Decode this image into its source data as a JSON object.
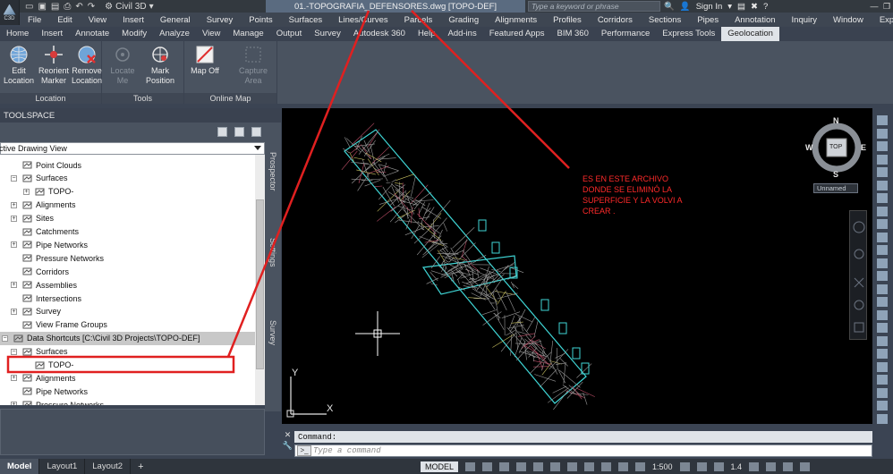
{
  "titlebar": {
    "app_logo_text": "C3D",
    "workspace": "Civil 3D",
    "document_title": "01.-TOPOGRAFIA_DEFENSORES.dwg [TOPO-DEF]",
    "search_placeholder": "Type a keyword or phrase",
    "sign_in": "Sign In",
    "help": "?"
  },
  "menu": [
    "File",
    "Edit",
    "View",
    "Insert",
    "General",
    "Survey",
    "Points",
    "Surfaces",
    "Lines/Curves",
    "Parcels",
    "Grading",
    "Alignments",
    "Profiles",
    "Corridors",
    "Sections",
    "Pipes",
    "Annotation",
    "Inquiry",
    "Window",
    "Express"
  ],
  "ribbon_tabs": [
    "Home",
    "Insert",
    "Annotate",
    "Modify",
    "Analyze",
    "View",
    "Manage",
    "Output",
    "Survey",
    "Autodesk 360",
    "Help",
    "Add-ins",
    "Featured Apps",
    "BIM 360",
    "Performance",
    "Express Tools",
    "Geolocation"
  ],
  "ribbon_active_tab": "Geolocation",
  "ribbon": {
    "location": {
      "label": "Location",
      "edit": "Edit Location",
      "reorient": "Reorient Marker",
      "remove": "Remove Location"
    },
    "tools": {
      "label": "Tools",
      "locate_me": "Locate Me",
      "mark_position": "Mark Position"
    },
    "online_map": {
      "label": "Online Map",
      "map_off": "Map Off",
      "capture_area": "Capture Area"
    }
  },
  "toolspace": {
    "title": "TOOLSPACE",
    "view_select": "Active Drawing View",
    "side_tabs": [
      "Prospector",
      "Settings",
      "Survey"
    ],
    "tree": [
      {
        "label": "Point Clouds",
        "expander": "",
        "indent": 1
      },
      {
        "label": "Surfaces",
        "expander": "−",
        "indent": 1
      },
      {
        "label": "TOPO-",
        "expander": "+",
        "indent": 2
      },
      {
        "label": "Alignments",
        "expander": "+",
        "indent": 1
      },
      {
        "label": "Sites",
        "expander": "+",
        "indent": 1
      },
      {
        "label": "Catchments",
        "expander": "",
        "indent": 1
      },
      {
        "label": "Pipe Networks",
        "expander": "+",
        "indent": 1
      },
      {
        "label": "Pressure Networks",
        "expander": "",
        "indent": 1
      },
      {
        "label": "Corridors",
        "expander": "",
        "indent": 1
      },
      {
        "label": "Assemblies",
        "expander": "+",
        "indent": 1
      },
      {
        "label": "Intersections",
        "expander": "",
        "indent": 1
      },
      {
        "label": "Survey",
        "expander": "+",
        "indent": 1
      },
      {
        "label": "View Frame Groups",
        "expander": "",
        "indent": 1
      },
      {
        "label": "Data Shortcuts [C:\\Civil 3D Projects\\TOPO-DEF]",
        "expander": "−",
        "indent": 0
      },
      {
        "label": "Surfaces",
        "expander": "−",
        "indent": 1
      },
      {
        "label": "TOPO-",
        "expander": "",
        "indent": 2
      },
      {
        "label": "Alignments",
        "expander": "+",
        "indent": 1
      },
      {
        "label": "Pipe Networks",
        "expander": "",
        "indent": 1
      },
      {
        "label": "Pressure Networks",
        "expander": "+",
        "indent": 1
      }
    ]
  },
  "annotation": "ES EN ESTE ARCHIVO DONDE SE ELIMINÓ LA SUPERFICIE Y LA VOLVI A CREAR .",
  "viewcube": {
    "face": "TOP",
    "n": "N",
    "s": "S",
    "e": "E",
    "w": "W",
    "ucs_menu": "Unnamed"
  },
  "ucs": {
    "x": "X",
    "y": "Y"
  },
  "command": {
    "history": "Command:",
    "placeholder": "Type a command"
  },
  "status": {
    "layout_tabs": [
      "Model",
      "Layout1",
      "Layout2"
    ],
    "add_tab": "+",
    "model": "MODEL",
    "scale": "1:500",
    "lineweight": "1.4"
  },
  "colors": {
    "annotation_red": "#ff2a2a",
    "surface_border": "#3fd6d6",
    "drawing_bg": "#000000"
  }
}
